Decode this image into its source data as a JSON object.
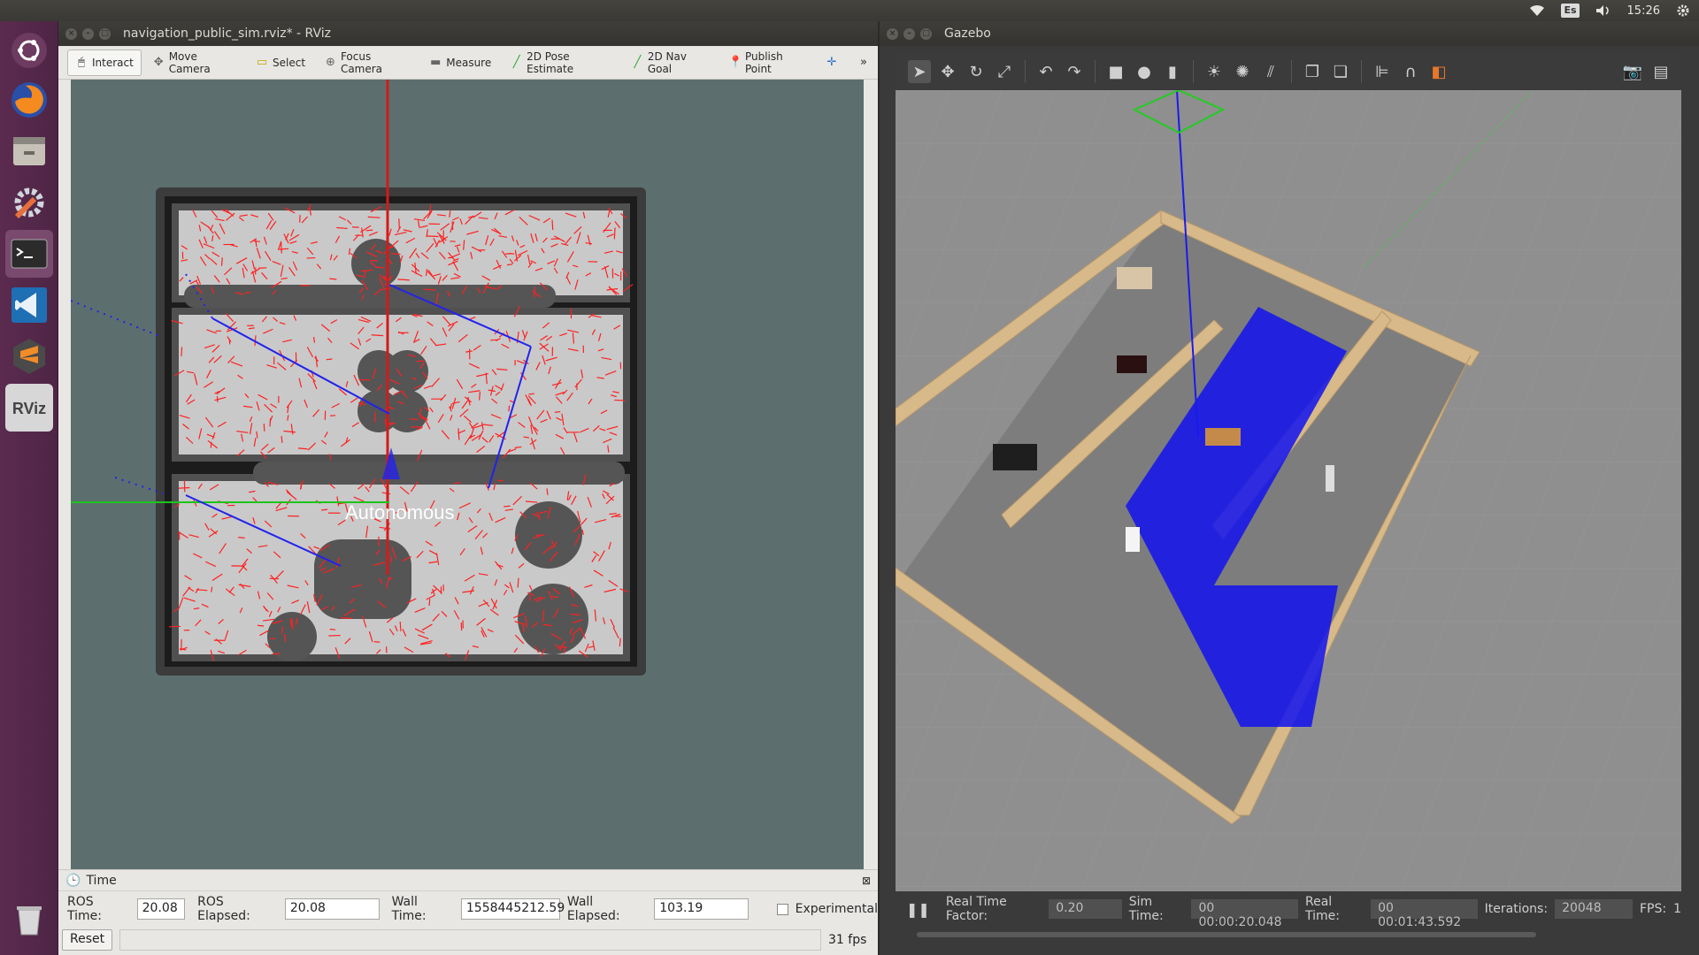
{
  "topbar": {
    "keyboard_layout": "Es",
    "clock": "15:26",
    "icons": [
      "wifi-icon",
      "keyboard-icon",
      "volume-icon",
      "settings-gear-icon"
    ]
  },
  "launcher": {
    "items": [
      {
        "name": "ubuntu-dash-icon"
      },
      {
        "name": "firefox-icon"
      },
      {
        "name": "file-manager-icon"
      },
      {
        "name": "system-settings-icon"
      },
      {
        "name": "terminal-icon"
      },
      {
        "name": "vscode-icon"
      },
      {
        "name": "sublime-text-icon"
      },
      {
        "name": "rviz-icon",
        "label": "RViz"
      },
      {
        "name": "trash-icon"
      }
    ]
  },
  "rviz": {
    "title": "navigation_public_sim.rviz* - RViz",
    "toolbar": [
      {
        "label": "Interact",
        "icon": "cursor-icon"
      },
      {
        "label": "Move Camera",
        "icon": "move-camera-icon"
      },
      {
        "label": "Select",
        "icon": "select-icon"
      },
      {
        "label": "Focus Camera",
        "icon": "focus-camera-icon"
      },
      {
        "label": "Measure",
        "icon": "measure-icon"
      },
      {
        "label": "2D Pose Estimate",
        "icon": "pose-estimate-icon"
      },
      {
        "label": "2D Nav Goal",
        "icon": "nav-goal-icon"
      },
      {
        "label": "Publish Point",
        "icon": "publish-point-icon"
      }
    ],
    "overlay_text": "Autonomous",
    "time_panel": {
      "title": "Time",
      "ros_time_label": "ROS Time:",
      "ros_time": "20.08",
      "ros_elapsed_label": "ROS Elapsed:",
      "ros_elapsed": "20.08",
      "wall_time_label": "Wall Time:",
      "wall_time": "1558445212.59",
      "wall_elapsed_label": "Wall Elapsed:",
      "wall_elapsed": "103.19",
      "experimental_label": "Experimental",
      "reset_label": "Reset",
      "fps": "31 fps"
    }
  },
  "gazebo": {
    "title": "Gazebo",
    "status": {
      "rtf_label": "Real Time Factor:",
      "rtf": "0.20",
      "sim_time_label": "Sim Time:",
      "sim_time": "00 00:00:20.048",
      "real_time_label": "Real Time:",
      "real_time": "00 00:01:43.592",
      "iterations_label": "Iterations:",
      "iterations": "20048",
      "fps_label": "FPS:",
      "fps": "1"
    }
  },
  "colors": {
    "launcher": "#5b2b4f",
    "rviz_bg": "#5c6f6e",
    "particle": "#ff2020",
    "costmap": "#3a3a3a",
    "laser_blue": "#1a1aff",
    "gazebo_bg": "#8f8f8f",
    "wall": "#d8b98a"
  }
}
